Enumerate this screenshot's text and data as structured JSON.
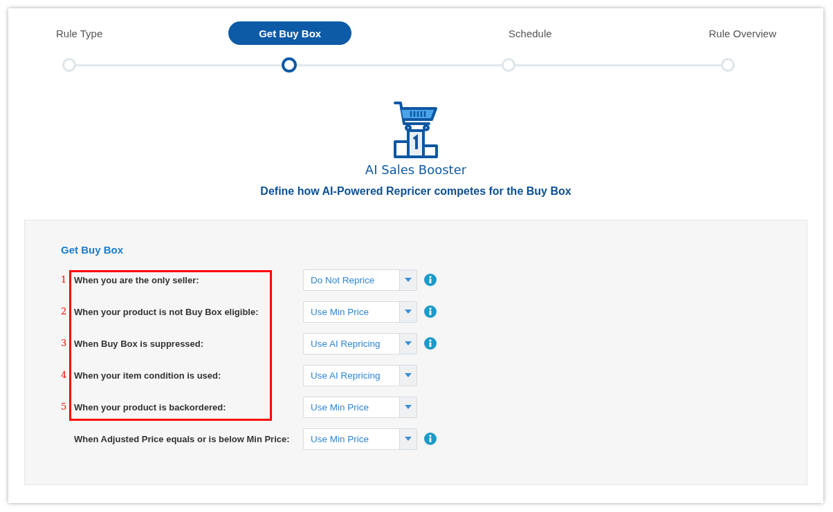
{
  "steps": [
    {
      "label": "Rule Type",
      "selected": false
    },
    {
      "label": "Get Buy Box",
      "selected": true
    },
    {
      "label": "Schedule",
      "selected": false
    },
    {
      "label": "Rule Overview",
      "selected": false
    }
  ],
  "hero": {
    "title": "AI Sales Booster",
    "subtitle": "Define how AI-Powered Repricer competes for the Buy Box"
  },
  "panel": {
    "title": "Get Buy Box",
    "annotated_rows": [
      {
        "marker": "1",
        "label": "When you are the only seller:",
        "value": "Do Not Reprice",
        "info": true
      },
      {
        "marker": "2",
        "label": "When your product is not Buy Box eligible:",
        "value": "Use Min Price",
        "info": true
      },
      {
        "marker": "3",
        "label": "When Buy Box is suppressed:",
        "value": "Use AI Repricing",
        "info": true
      },
      {
        "marker": "4",
        "label": "When your item condition is used:",
        "value": "Use AI Repricing",
        "info": false
      },
      {
        "marker": "5",
        "label": "When your product is backordered:",
        "value": "Use Min Price",
        "info": false
      }
    ],
    "rows": [
      {
        "label": "When Adjusted Price equals or is below Min Price:",
        "value": "Use Min Price",
        "info": true
      }
    ]
  }
}
